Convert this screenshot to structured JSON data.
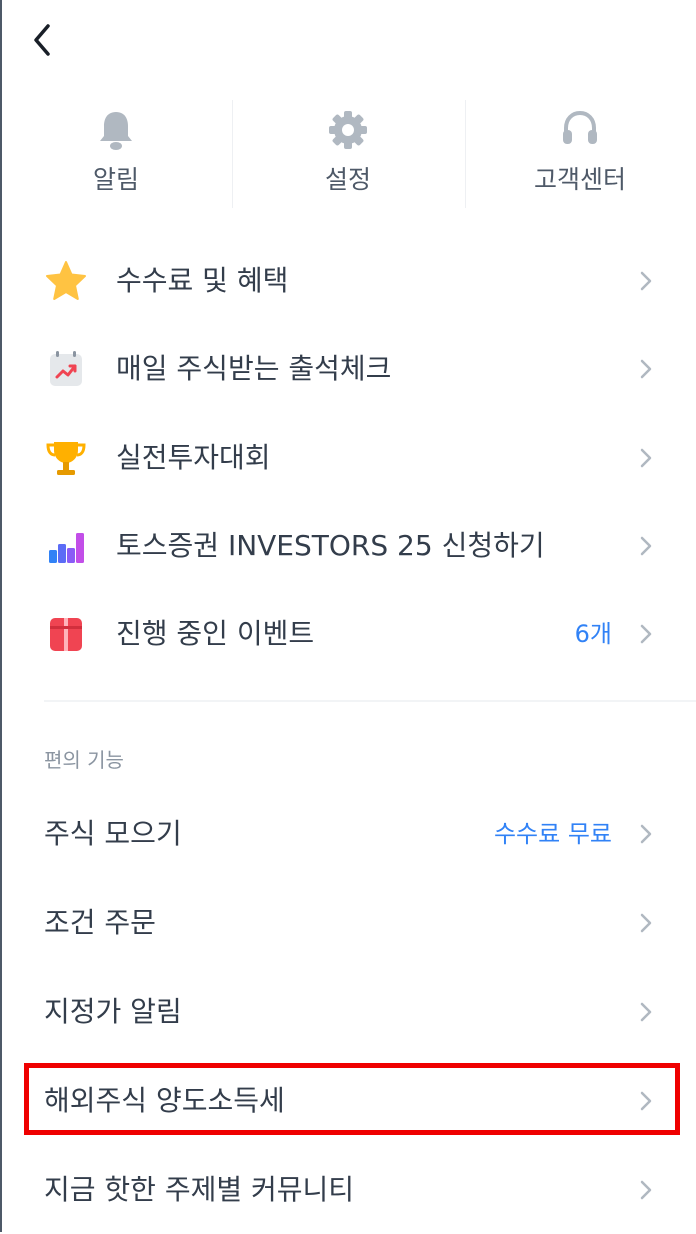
{
  "header": {
    "back_icon": "chevron-left-icon"
  },
  "quick_actions": [
    {
      "label": "알림",
      "icon": "bell-icon"
    },
    {
      "label": "설정",
      "icon": "gear-icon"
    },
    {
      "label": "고객센터",
      "icon": "headset-icon"
    }
  ],
  "menu": [
    {
      "label": "수수료 및 혜택",
      "icon": "star-icon",
      "badge": ""
    },
    {
      "label": "매일 주식받는 출석체크",
      "icon": "calendar-chart-icon",
      "badge": ""
    },
    {
      "label": "실전투자대회",
      "icon": "trophy-icon",
      "badge": ""
    },
    {
      "label": "토스증권 INVESTORS 25 신청하기",
      "icon": "bar-chart-icon",
      "badge": ""
    },
    {
      "label": "진행 중인 이벤트",
      "icon": "gift-icon",
      "badge": "6개"
    }
  ],
  "convenience": {
    "title": "편의 기능",
    "items": [
      {
        "label": "주식 모으기",
        "badge": "수수료 무료"
      },
      {
        "label": "조건 주문",
        "badge": ""
      },
      {
        "label": "지정가 알림",
        "badge": ""
      },
      {
        "label": "해외주식 양도소득세",
        "badge": "",
        "highlighted": true
      },
      {
        "label": "지금 핫한 주제별 커뮤니티",
        "badge": ""
      }
    ]
  },
  "colors": {
    "accent": "#3182f6",
    "highlight": "#ef0000",
    "text": "#333d4b",
    "muted": "#8b95a1"
  }
}
